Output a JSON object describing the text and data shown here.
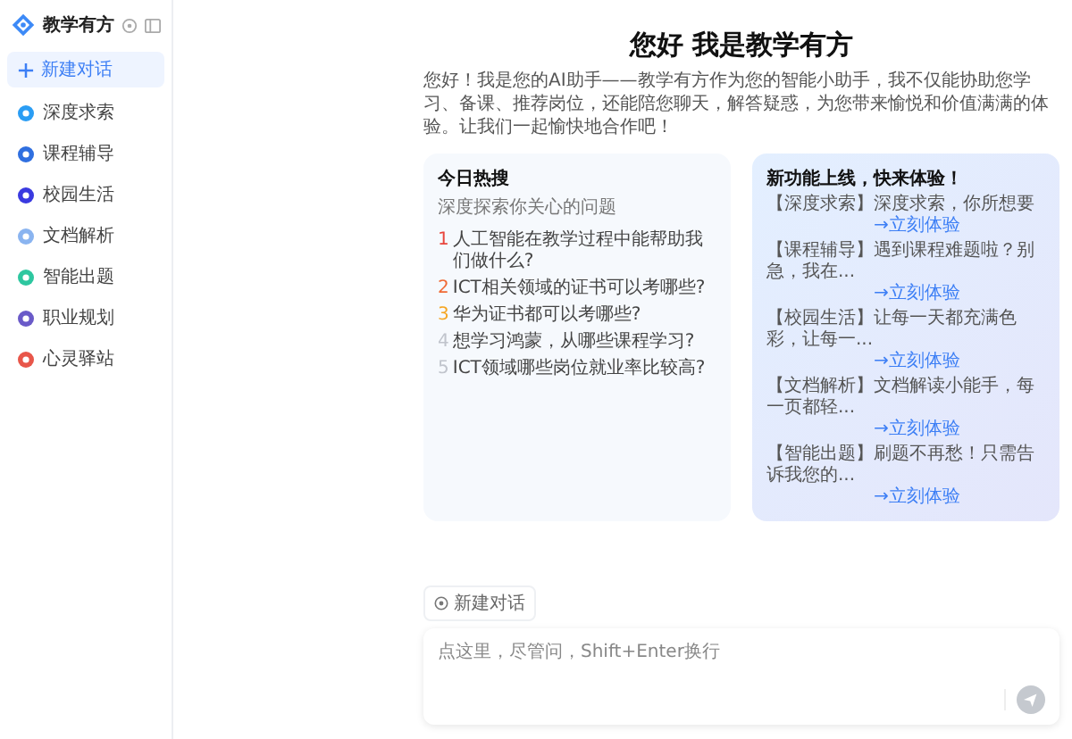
{
  "sidebar": {
    "app_name": "教学有方",
    "new_chat": {
      "label": "新建对话",
      "selected": true
    },
    "items": [
      {
        "label": "深度求索",
        "color": "#2a9df4"
      },
      {
        "label": "课程辅导",
        "color": "#2f6fe0"
      },
      {
        "label": "校园生活",
        "color": "#3a3ae0"
      },
      {
        "label": "文档解析",
        "color": "#8ab4f0"
      },
      {
        "label": "智能出题",
        "color": "#2ec7a0"
      },
      {
        "label": "职业规划",
        "color": "#6a5ac8"
      },
      {
        "label": "心灵驿站",
        "color": "#e8564a"
      }
    ]
  },
  "main": {
    "title": "您好 我是教学有方",
    "intro": "您好！我是您的AI助手——教学有方作为您的智能小助手，我不仅能协助您学习、备课、推荐岗位，还能陪您聊天，解答疑惑，为您带来愉悦和价值满满的体验。让我们一起愉快地合作吧！",
    "hot": {
      "title": "今日热搜",
      "subtitle": "深度探索你关心的问题",
      "items": [
        {
          "rank": "1",
          "text": "人工智能在教学过程中能帮助我们做什么?",
          "color": "#e8453c"
        },
        {
          "rank": "2",
          "text": "ICT相关领域的证书可以考哪些?",
          "color": "#f06a35"
        },
        {
          "rank": "3",
          "text": "华为证书都可以考哪些?",
          "color": "#f5a623"
        },
        {
          "rank": "4",
          "text": "想学习鸿蒙，从哪些课程学习?",
          "color": "#c0c4cc"
        },
        {
          "rank": "5",
          "text": "ICT领域哪些岗位就业率比较高?",
          "color": "#c0c4cc"
        }
      ]
    },
    "features": {
      "title": "新功能上线，快来体验！",
      "items": [
        {
          "tag": "【深度求索】",
          "desc": "深度求索，你所想要",
          "link": "→立刻体验"
        },
        {
          "tag": "【课程辅导】",
          "desc": "遇到课程难题啦？别急，我在...",
          "link": "→立刻体验"
        },
        {
          "tag": "【校园生活】",
          "desc": "让每一天都充满色彩，让每一...",
          "link": "→立刻体验"
        },
        {
          "tag": "【文档解析】",
          "desc": "文档解读小能手，每一页都轻...",
          "link": "→立刻体验"
        },
        {
          "tag": "【智能出题】",
          "desc": "刷题不再愁！只需告诉我您的...",
          "link": "→立刻体验"
        }
      ]
    },
    "new_chat_button": "新建对话",
    "input": {
      "placeholder": "点这里，尽管问，Shift+Enter换行"
    }
  }
}
